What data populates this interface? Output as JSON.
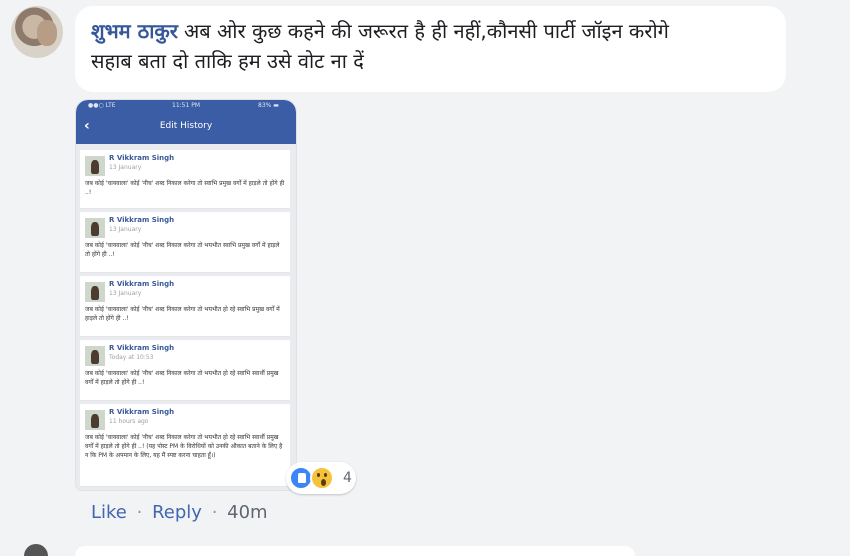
{
  "comment": {
    "author": "शुभम ठाकुर",
    "text_line1": "अब ओर कुछ कहने की जरूरत है ही नहीं,कौनसी पार्टी जॉइन करोगे",
    "text_line2": "सहाब बता दो ताकि हम उसे वोट ना दें"
  },
  "screenshot": {
    "status_left": "●●○ LTE",
    "status_time": "11:51 PM",
    "status_right": "83% ▬",
    "back_icon": "‹",
    "title": "Edit History",
    "entries": [
      {
        "name": "R Vikkram Singh",
        "date": "13 January",
        "text": "जब कोई 'चायवाला' कोई 'नीच' शब्द निकाल करेगा तो स्वाभि प्रमुख वर्गों में हाड़ले तो होंगे ही ..!"
      },
      {
        "name": "R Vikkram Singh",
        "date": "13 January",
        "text": "जब कोई 'चायवाला' कोई 'नीच' शब्द निकाल करेगा तो भयभीत स्वाभि प्रमुख वर्गों में हाड़ले तो होंगे ही ..!"
      },
      {
        "name": "R Vikkram Singh",
        "date": "13 January",
        "text": "जब कोई 'चायवाला' कोई 'नीच' शब्द निकाल करेगा तो भयभीत हो रहे स्वाभि प्रमुख वर्गों में हाड़ले तो होंगे ही ..!"
      },
      {
        "name": "R Vikkram Singh",
        "date": "Today at 10:53",
        "text": "जब कोई 'चायवाला' कोई 'नीच' शब्द निकाल करेगा तो भयभीत हो रहे स्वाभि स्वार्थी प्रमुख वर्गों में हाड़ले तो होंगे ही ..!"
      },
      {
        "name": "R Vikkram Singh",
        "date": "11 hours ago",
        "text": "जब कोई 'चायवाला' कोई 'नीच' शब्द निकाल करेगा तो भयभीत हो रहे स्वाभि स्वार्थी प्रमुख वर्गों में हाड़ले तो होंगे ही ..! (यह पोस्ट PM के विरोधियों को उनकी औकात बताने के लिए है न कि PM के अपमान के लिए, यह मैं स्पष्ट करना चाहता हूँ।)"
      }
    ]
  },
  "reactions": {
    "icons": [
      "like-icon",
      "wow-icon"
    ],
    "count": "4"
  },
  "actions": {
    "like": "Like",
    "reply": "Reply",
    "separator": "·",
    "time": "40m"
  }
}
